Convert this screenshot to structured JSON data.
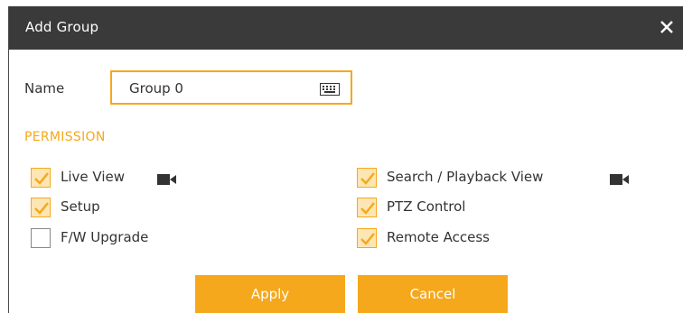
{
  "dialog": {
    "title": "Add Group",
    "close_icon": "close-icon"
  },
  "name": {
    "label": "Name",
    "value": "Group 0",
    "keyboard_icon": "keyboard-icon"
  },
  "permission": {
    "section_label": "PERMISSION",
    "items": [
      {
        "label": "Live View",
        "checked": true,
        "icon": "camera-icon"
      },
      {
        "label": "Setup",
        "checked": true
      },
      {
        "label": "F/W Upgrade",
        "checked": false
      },
      {
        "label": "Search / Playback View",
        "checked": true,
        "icon": "camera-icon"
      },
      {
        "label": "PTZ Control",
        "checked": true
      },
      {
        "label": "Remote Access",
        "checked": true
      }
    ]
  },
  "buttons": {
    "apply_label": "Apply",
    "cancel_label": "Cancel"
  },
  "colors": {
    "accent": "#f5a81c",
    "titlebar": "#3a3a3a"
  }
}
